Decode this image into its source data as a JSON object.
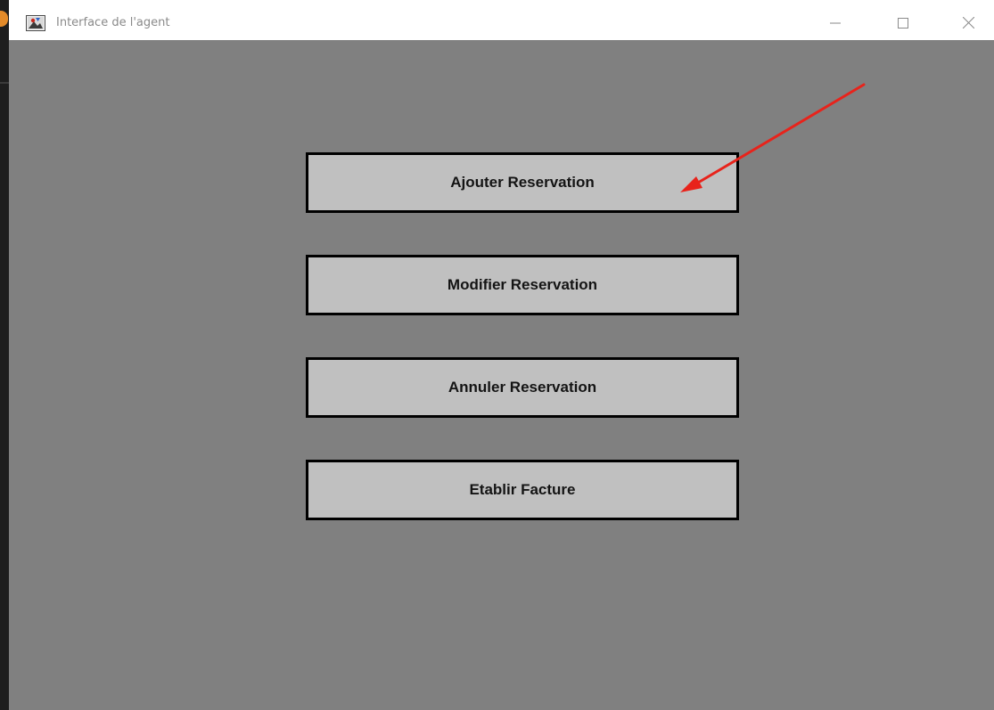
{
  "window": {
    "title": "Interface de l'agent",
    "controls": {
      "minimize": "minimize-icon",
      "maximize": "maximize-icon",
      "close": "close-icon"
    }
  },
  "actions": [
    {
      "label": "Ajouter Reservation"
    },
    {
      "label": "Modifier Reservation"
    },
    {
      "label": "Annuler Reservation"
    },
    {
      "label": "Etablir Facture"
    }
  ],
  "colors": {
    "background": "#808080",
    "button_fill": "#c0c0c0",
    "button_border": "#000000",
    "annotation_arrow": "#e8231b"
  }
}
